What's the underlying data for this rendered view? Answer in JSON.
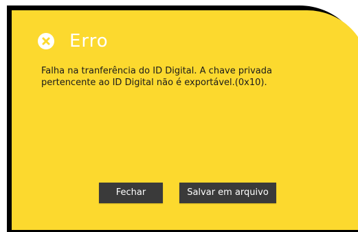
{
  "dialog": {
    "title": "Erro",
    "icon": "close-icon",
    "message_line1": "Falha na tranferência do ID Digital. A chave privada",
    "message_line2": "pertencente ao ID Digital não é exportável.(0x10).",
    "close_label": "Fechar",
    "save_label": "Salvar em arquivo"
  },
  "colors": {
    "background": "#fcd92e",
    "title_text": "#ffffff",
    "button_bg": "#3a3a3a",
    "button_text": "#ffffff"
  }
}
